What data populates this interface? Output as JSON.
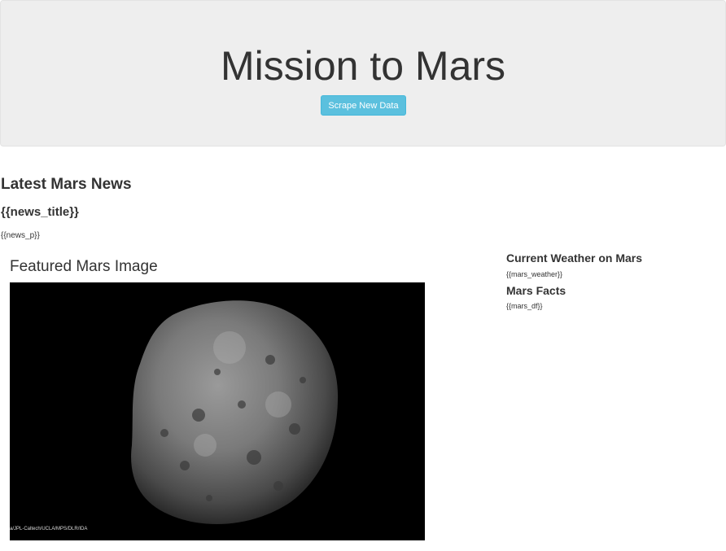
{
  "header": {
    "title": "Mission to Mars",
    "scrape_button_label": "Scrape New Data"
  },
  "news": {
    "heading": "Latest Mars News",
    "title_placeholder": "{{news_title}}",
    "paragraph_placeholder": "{{news_p}}"
  },
  "featured_image": {
    "heading": "Featured Mars Image",
    "credit": "a/JPL-Caltech/UCLA/MPS/DLR/IDA"
  },
  "weather": {
    "heading": "Current Weather on Mars",
    "placeholder": "{{mars_weather}}"
  },
  "facts": {
    "heading": "Mars Facts",
    "placeholder": "{{mars_df}}"
  },
  "colors": {
    "jumbotron_bg": "#eeeeee",
    "button_bg": "#5bc0de",
    "text": "#333333"
  }
}
